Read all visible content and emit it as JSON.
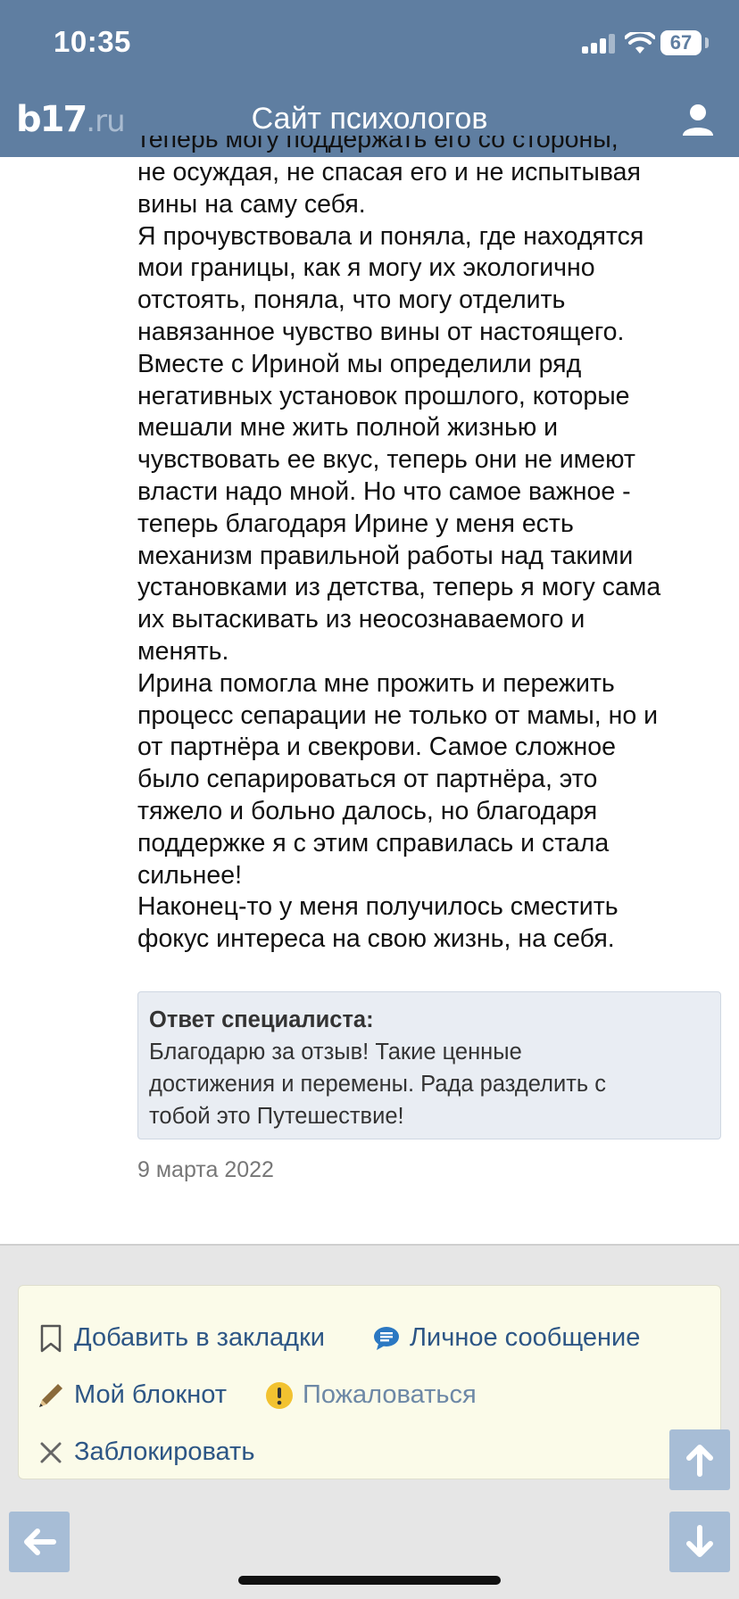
{
  "status_bar": {
    "time": "10:35",
    "battery": "67"
  },
  "header": {
    "logo_b17": "b17",
    "logo_ru": ".ru",
    "title": "Сайт психологов"
  },
  "review": {
    "cut_line": "теперь могу поддержать его со стороны,",
    "lines": [
      "не осуждая, не спасая его и не испытывая",
      "вины на саму себя.",
      "Я прочувствовала и поняла, где находятся",
      "мои границы, как я могу их экологично",
      "отстоять, поняла, что могу отделить",
      "навязанное чувство вины от настоящего.",
      "Вместе с Ириной мы определили ряд",
      "негативных установок прошлого, которые",
      "мешали мне жить полной жизнью и",
      "чувствовать ее вкус, теперь они не имеют",
      "власти надо мной. Но что самое важное -",
      "теперь благодаря Ирине у меня есть",
      "механизм правильной работы над такими",
      "установками из детства, теперь я могу сама",
      "их вытаскивать из неосознаваемого и",
      "менять.",
      "Ирина помогла мне прожить и пережить",
      "процесс сепарации не только от мамы, но и",
      "от партнёра и свекрови. Самое сложное",
      "было сепарироваться от партнёра, это",
      "тяжело и больно далось, но благодаря",
      "поддержке я с этим справилась и стала",
      "сильнее!",
      "Наконец-то у меня получилось сместить",
      "фокус интереса на свою жизнь, на себя."
    ],
    "reply": {
      "title": "Ответ специалиста:",
      "lines": [
        "Благодарю за отзыв! Такие ценные",
        "достижения и перемены. Рада разделить с",
        "тобой это Путешествие!"
      ]
    },
    "date": "9 марта 2022"
  },
  "actions": {
    "bookmark": "Добавить в закладки",
    "message": "Личное сообщение",
    "notebook": "Мой блокнот",
    "report": "Пожаловаться",
    "block": "Заблокировать"
  },
  "colors": {
    "header_bg": "#5f7ea1",
    "link": "#2d5685",
    "reply_bg": "#e9edf3",
    "actions_bg": "#fbfbe9",
    "scroll_btn": "#a7bdd6"
  },
  "icons": [
    "bookmark-icon",
    "chat-icon",
    "pencil-icon",
    "warning-icon",
    "close-icon",
    "user-icon",
    "arrow-up-icon",
    "arrow-down-icon",
    "arrow-left-icon"
  ]
}
